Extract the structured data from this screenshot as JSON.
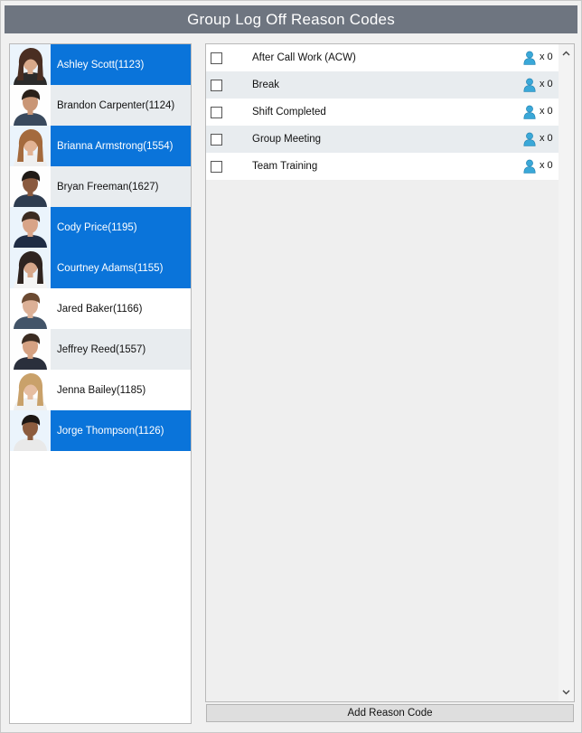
{
  "window": {
    "title": "Group Log Off Reason Codes"
  },
  "agents": [
    {
      "name": "Ashley Scott(1123)",
      "state": "selected",
      "avatar": "female-avatar",
      "skin": "#d9a98a",
      "hair": "#4a2e22",
      "shirt": "#2b2b2b"
    },
    {
      "name": "Brandon Carpenter(1124)",
      "state": "alt",
      "avatar": "male-avatar",
      "skin": "#c99676",
      "hair": "#2a2019",
      "shirt": "#3a4a5e"
    },
    {
      "name": "Brianna Armstrong(1554)",
      "state": "selected",
      "avatar": "female-avatar",
      "skin": "#e2b394",
      "hair": "#a46a3d",
      "shirt": "#efefef"
    },
    {
      "name": "Bryan Freeman(1627)",
      "state": "alt",
      "avatar": "male-avatar",
      "skin": "#8a5a3f",
      "hair": "#1f1a16",
      "shirt": "#2e3c50"
    },
    {
      "name": "Cody Price(1195)",
      "state": "selected",
      "avatar": "male-avatar",
      "skin": "#d8a488",
      "hair": "#3a2b20",
      "shirt": "#1f2c44"
    },
    {
      "name": "Courtney Adams(1155)",
      "state": "selected",
      "avatar": "female-avatar",
      "skin": "#d6a689",
      "hair": "#2f2420",
      "shirt": "#f4f4f4"
    },
    {
      "name": "Jared Baker(1166)",
      "state": "plain",
      "avatar": "male-avatar",
      "skin": "#dcb096",
      "hair": "#6b4a32",
      "shirt": "#425468"
    },
    {
      "name": "Jeffrey Reed(1557)",
      "state": "alt",
      "avatar": "male-avatar",
      "skin": "#d5a182",
      "hair": "#3b2c22",
      "shirt": "#2a2f3c"
    },
    {
      "name": "Jenna Bailey(1185)",
      "state": "plain",
      "avatar": "female-avatar",
      "skin": "#e6bea2",
      "hair": "#c9a16a",
      "shirt": "#f0f0f0"
    },
    {
      "name": "Jorge Thompson(1126)",
      "state": "selected",
      "avatar": "male-avatar",
      "skin": "#8c5c3e",
      "hair": "#1c1714",
      "shirt": "#e9e9e9"
    }
  ],
  "reason_codes": [
    {
      "label": "After Call Work (ACW)",
      "count": "x 0",
      "checked": false
    },
    {
      "label": "Break",
      "count": "x 0",
      "checked": false
    },
    {
      "label": "Shift Completed",
      "count": "x 0",
      "checked": false
    },
    {
      "label": "Group Meeting",
      "count": "x 0",
      "checked": false
    },
    {
      "label": "Team Training",
      "count": "x 0",
      "checked": false
    }
  ],
  "icons": {
    "count_icon": "person-icon",
    "scroll_up": "chevron-up-icon",
    "scroll_down": "chevron-down-icon"
  },
  "colors": {
    "title_bar": "#6e7580",
    "selected_row": "#0a74da",
    "alt_row": "#e8ecef",
    "person_icon": "#3aa8d8"
  },
  "footer": {
    "add_button_label": "Add Reason Code"
  }
}
